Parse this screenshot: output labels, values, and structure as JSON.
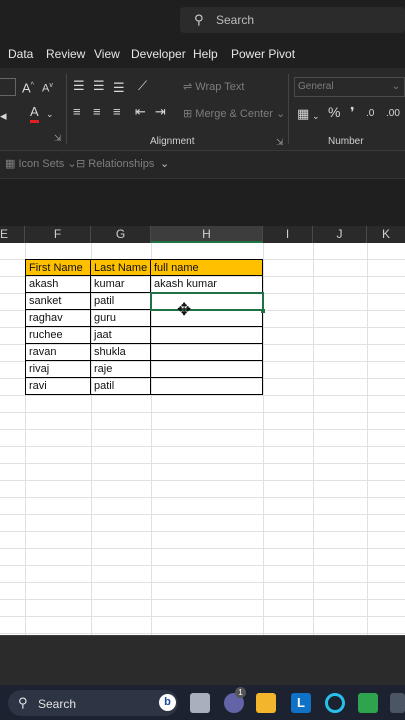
{
  "titlebar": {
    "search_placeholder": "Search"
  },
  "menu": [
    "Data",
    "Review",
    "View",
    "Developer",
    "Help",
    "Power Pivot"
  ],
  "ribbon": {
    "wrap_text": "Wrap Text",
    "merge_center": "Merge & Center",
    "number_format": "General",
    "group_alignment": "Alignment",
    "group_number": "Number",
    "icon_sets": "Icon Sets",
    "relationships": "Relationships"
  },
  "columns": [
    "E",
    "F",
    "G",
    "H",
    "I",
    "J",
    "K"
  ],
  "sheet": {
    "headers": [
      "First Name",
      "Last Name",
      "full name"
    ],
    "rows": [
      [
        "akash",
        "kumar",
        "akash kumar"
      ],
      [
        "sanket",
        "patil",
        ""
      ],
      [
        "raghav",
        "guru",
        ""
      ],
      [
        "ruchee",
        "jaat",
        ""
      ],
      [
        "ravan",
        "shukla",
        ""
      ],
      [
        "rivaj",
        "raje",
        ""
      ],
      [
        "ravi",
        "patil",
        ""
      ]
    ]
  },
  "taskbar": {
    "search_label": "Search",
    "badge": "1"
  },
  "colors": {
    "header_fill": "#ffc000",
    "active_cell": "#1e7145",
    "taskbar": "#1c2230"
  }
}
